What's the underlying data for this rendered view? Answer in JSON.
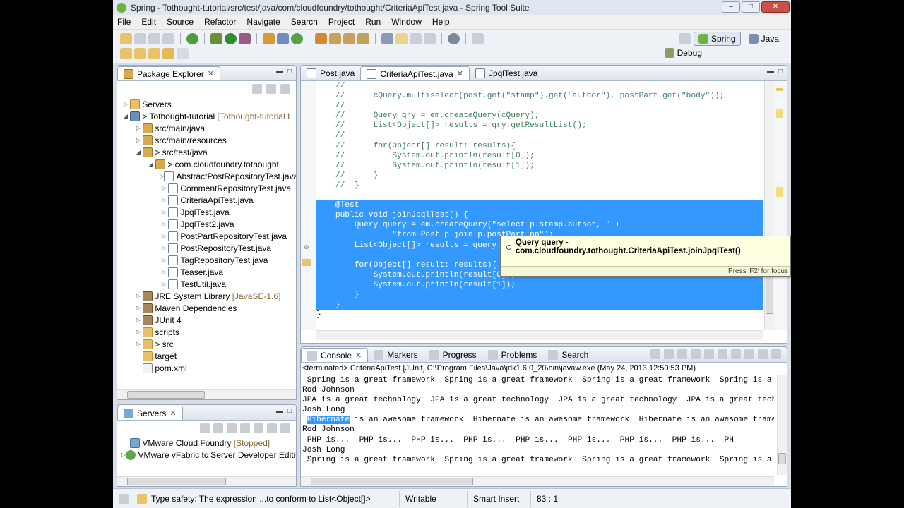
{
  "window": {
    "title": "Spring - Tothought-tutorial/src/test/java/com/cloudfoundry/tothought/CriteriaApiTest.java - Spring Tool Suite"
  },
  "menu": [
    "File",
    "Edit",
    "Source",
    "Refactor",
    "Navigate",
    "Search",
    "Project",
    "Run",
    "Window",
    "Help"
  ],
  "perspectives": {
    "spring": "Spring",
    "java": "Java",
    "debug": "Debug"
  },
  "package_explorer": {
    "title": "Package Explorer",
    "items": [
      {
        "label": "Servers",
        "dec": ""
      },
      {
        "label": "> Tothought-tutorial",
        "dec": "[Tothought-tutorial I"
      },
      {
        "label": "src/main/java",
        "dec": ""
      },
      {
        "label": "src/main/resources",
        "dec": ""
      },
      {
        "label": "> src/test/java",
        "dec": ""
      },
      {
        "label": "> com.cloudfoundry.tothought",
        "dec": ""
      },
      {
        "label": "AbstractPostRepositoryTest.java",
        "dec": ""
      },
      {
        "label": "CommentRepositoryTest.java",
        "dec": ""
      },
      {
        "label": "CriteriaApiTest.java",
        "dec": ""
      },
      {
        "label": "JpqlTest.java",
        "dec": ""
      },
      {
        "label": "JpqlTest2.java",
        "dec": ""
      },
      {
        "label": "PostPartRepositoryTest.java",
        "dec": ""
      },
      {
        "label": "PostRepositoryTest.java",
        "dec": ""
      },
      {
        "label": "TagRepositoryTest.java",
        "dec": ""
      },
      {
        "label": "Teaser.java",
        "dec": ""
      },
      {
        "label": "TestUtil.java",
        "dec": ""
      },
      {
        "label": "JRE System Library",
        "dec": "[JavaSE-1.6]"
      },
      {
        "label": "Maven Dependencies",
        "dec": ""
      },
      {
        "label": "JUnit 4",
        "dec": ""
      },
      {
        "label": "scripts",
        "dec": ""
      },
      {
        "label": "> src",
        "dec": ""
      },
      {
        "label": "target",
        "dec": ""
      },
      {
        "label": "pom.xml",
        "dec": ""
      }
    ]
  },
  "servers_view": {
    "title": "Servers",
    "items": [
      {
        "label": "VMware Cloud Foundry",
        "dec": "[Stopped]"
      },
      {
        "label": "VMware vFabric tc Server Developer Edition",
        "dec": ""
      }
    ]
  },
  "editor": {
    "tabs": [
      "Post.java",
      "CriteriaApiTest.java",
      "JpqlTest.java"
    ],
    "lines": [
      {
        "text": "    //",
        "sel": false
      },
      {
        "text": "    //      cQuery.multiselect(post.get(\"stamp\").get(\"author\"), postPart.get(\"body\"));",
        "sel": false
      },
      {
        "text": "    //",
        "sel": false
      },
      {
        "text": "    //      Query qry = em.createQuery(cQuery);",
        "sel": false
      },
      {
        "text": "    //      List<Object[]> results = qry.getResultList();",
        "sel": false
      },
      {
        "text": "    //",
        "sel": false
      },
      {
        "text": "    //      for(Object[] result: results){",
        "sel": false
      },
      {
        "text": "    //          System.out.println(result[0]);",
        "sel": false
      },
      {
        "text": "    //          System.out.println(result[1]);",
        "sel": false
      },
      {
        "text": "    //      }",
        "sel": false
      },
      {
        "text": "    //  }",
        "sel": false
      },
      {
        "text": "",
        "sel": false
      },
      {
        "text": "    @Test",
        "sel": true
      },
      {
        "text": "    public void joinJpqlTest() {",
        "sel": true
      },
      {
        "text": "        Query query = em.createQuery(\"select p.stamp.author, \" +",
        "sel": true
      },
      {
        "text": "                \"from Post p join p.postPart pp\");",
        "sel": true
      },
      {
        "text": "        List<Object[]> results = query.getResultList();",
        "sel": true
      },
      {
        "text": "",
        "sel": true
      },
      {
        "text": "        for(Object[] result: results){",
        "sel": true
      },
      {
        "text": "            System.out.println(result[0]);",
        "sel": true
      },
      {
        "text": "            System.out.println(result[1]);",
        "sel": true
      },
      {
        "text": "        }",
        "sel": true
      },
      {
        "text": "    }",
        "sel": true
      },
      {
        "text": "}",
        "sel": false
      }
    ],
    "tooltip": {
      "text": "Query query - com.cloudfoundry.tothought.CriteriaApiTest.joinJpqlTest()",
      "footer": "Press 'F2' for focus"
    }
  },
  "bottom": {
    "tabs": [
      "Console",
      "Markers",
      "Progress",
      "Problems",
      "Search"
    ],
    "header": "<terminated> CriteriaApiTest [JUnit] C:\\Program Files\\Java\\jdk1.6.0_20\\bin\\javaw.exe (May 24, 2013 12:50:53 PM)",
    "lines": [
      {
        "pre": " Spring is a great framework  Spring is a great framework  Spring is a great framework  Spring is a gr",
        "hl": "",
        "post": ""
      },
      {
        "pre": "Rod Johnson",
        "hl": "",
        "post": ""
      },
      {
        "pre": "JPA is a great technology  JPA is a great technology  JPA is a great technology  JPA is a great techno",
        "hl": "",
        "post": ""
      },
      {
        "pre": "Josh Long",
        "hl": "",
        "post": ""
      },
      {
        "pre": " ",
        "hl": "Hibernate",
        "post": " is an awesome framework  Hibernate is an awesome framework  Hibernate is an awesome framewo"
      },
      {
        "pre": "Rod Johnson",
        "hl": "",
        "post": ""
      },
      {
        "pre": " PHP is...  PHP is...  PHP is...  PHP is...  PHP is...  PHP is...  PHP is...  PHP is...  PH",
        "hl": "",
        "post": ""
      },
      {
        "pre": "Josh Long",
        "hl": "",
        "post": ""
      },
      {
        "pre": " Spring is a great framework  Spring is a great framework  Spring is a great framework  Spring is a gr",
        "hl": "",
        "post": ""
      }
    ]
  },
  "status": {
    "message": "Type safety: The expression ...to conform to List<Object[]>",
    "writable": "Writable",
    "insert_mode": "Smart Insert",
    "position": "83 : 1"
  },
  "colors": {
    "selection": "#3399ff",
    "comment": "#3f7f5f",
    "keyword": "#7f0055"
  }
}
